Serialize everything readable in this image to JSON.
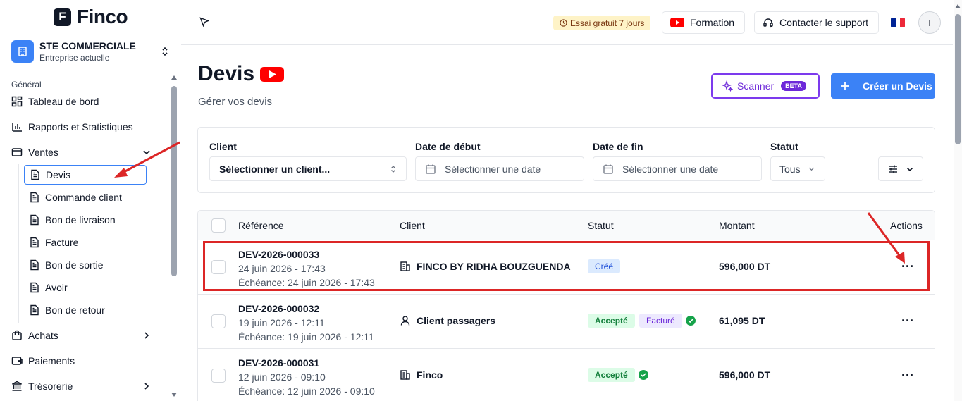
{
  "app": {
    "logo_letter": "F",
    "logo_text": "Finco"
  },
  "company": {
    "name": "STE COMMERCIALE",
    "subtitle": "Entreprise actuelle"
  },
  "sidebar": {
    "section": "Général",
    "items": [
      {
        "label": "Tableau de bord",
        "icon": "dashboard-icon"
      },
      {
        "label": "Rapports et Statistiques",
        "icon": "bar-chart-icon"
      },
      {
        "label": "Ventes",
        "icon": "wallet-icon",
        "expanded": true
      },
      {
        "label": "Achats",
        "icon": "bag-icon"
      },
      {
        "label": "Paiements",
        "icon": "card-icon"
      },
      {
        "label": "Trésorerie",
        "icon": "bank-icon"
      }
    ],
    "sub_items": [
      {
        "label": "Devis",
        "active": true
      },
      {
        "label": "Commande client"
      },
      {
        "label": "Bon de livraison"
      },
      {
        "label": "Facture"
      },
      {
        "label": "Bon de sortie"
      },
      {
        "label": "Avoir"
      },
      {
        "label": "Bon de retour"
      }
    ]
  },
  "topbar": {
    "trial": "Essai gratuit 7 jours",
    "formation": "Formation",
    "support": "Contacter le support",
    "avatar": "I"
  },
  "page": {
    "title": "Devis",
    "subtitle": "Gérer vos devis",
    "scanner": "Scanner",
    "beta": "BETA",
    "create": "Créer un Devis"
  },
  "filters": {
    "client_label": "Client",
    "client_value": "Sélectionner un client...",
    "start_label": "Date de début",
    "start_placeholder": "Sélectionner une date",
    "end_label": "Date de fin",
    "end_placeholder": "Sélectionner une date",
    "status_label": "Statut",
    "status_value": "Tous"
  },
  "table": {
    "headers": {
      "reference": "Référence",
      "client": "Client",
      "status": "Statut",
      "amount": "Montant",
      "actions": "Actions"
    },
    "rows": [
      {
        "code": "DEV-2026-000033",
        "date": "24 juin 2026 - 17:43",
        "due": "Échéance: 24 juin 2026 - 17:43",
        "client": "FINCO BY RIDHA BOUZGUENDA",
        "status": "Créé",
        "amount": "596,000 DT"
      },
      {
        "code": "DEV-2026-000032",
        "date": "19 juin 2026 - 12:11",
        "due": "Échéance: 19 juin 2026 - 12:11",
        "client": "Client passagers",
        "status": "Accepté",
        "status2": "Facturé",
        "amount": "61,095 DT"
      },
      {
        "code": "DEV-2026-000031",
        "date": "12 juin 2026 - 09:10",
        "due": "Échéance: 12 juin 2026 - 09:10",
        "client": "Finco",
        "status": "Accepté",
        "amount": "596,000 DT"
      }
    ]
  },
  "colors": {
    "accent": "#3b82f6",
    "annotation": "#dc2626",
    "scanner": "#7c3aed"
  }
}
